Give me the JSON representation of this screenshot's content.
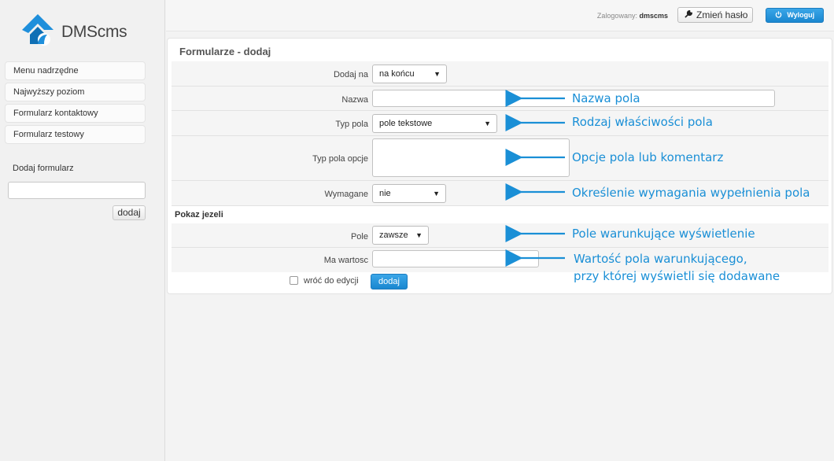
{
  "brand": {
    "name": "DMScms",
    "colors": {
      "accent": "#1a87d0",
      "logo_blue": "#2b9be0"
    }
  },
  "sidebar": {
    "items": [
      {
        "label": "Menu nadrzędne"
      },
      {
        "label": "Najwyższy poziom"
      },
      {
        "label": "Formularz kontaktowy"
      },
      {
        "label": "Formularz testowy"
      }
    ],
    "add_form": {
      "label": "Dodaj formularz",
      "value": "",
      "button": "dodaj"
    }
  },
  "topbar": {
    "logged_label": "Zalogowany:",
    "user": "dmscms",
    "change_password": "Zmień hasło",
    "logout": "Wyloguj"
  },
  "panel": {
    "title": "Formularze - dodaj",
    "fields": {
      "add_at": {
        "label": "Dodaj na",
        "value": "na końcu"
      },
      "name": {
        "label": "Nazwa",
        "value": ""
      },
      "type": {
        "label": "Typ pola",
        "value": "pole tekstowe"
      },
      "type_options": {
        "label": "Typ pola opcje",
        "value": ""
      },
      "required": {
        "label": "Wymagane",
        "value": "nie"
      }
    },
    "section_show_if": "Pokaz jezeli",
    "condition": {
      "field": {
        "label": "Pole",
        "value": "zawsze"
      },
      "value": {
        "label": "Ma wartosc",
        "value": ""
      }
    },
    "back_to_edit": "wróć do edycji",
    "submit": "dodaj"
  },
  "annotations": {
    "name": "Nazwa pola",
    "type": "Rodzaj właściwości pola",
    "options": "Opcje pola lub komentarz",
    "required": "Określenie wymagania wypełnienia pola",
    "condition_field": "Pole warunkujące wyświetlenie",
    "condition_value_line1": "Wartość pola warunkującego,",
    "condition_value_line2": "przy której wyświetli się dodawane"
  }
}
